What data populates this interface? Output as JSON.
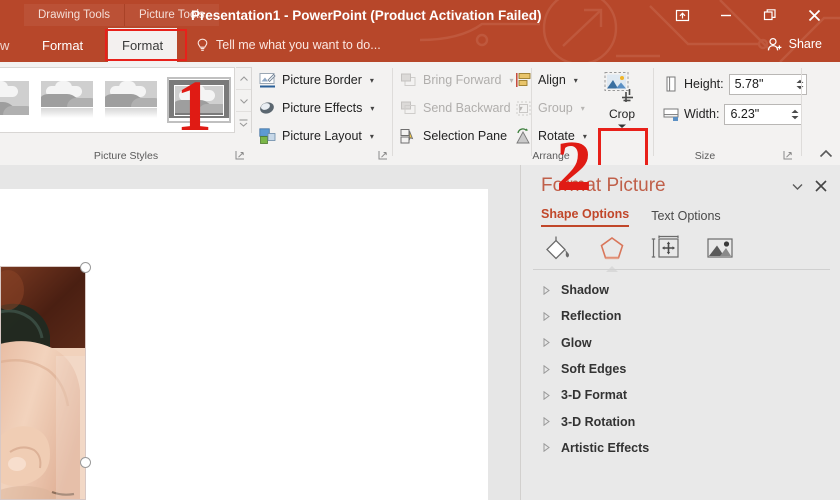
{
  "window": {
    "title": "Presentation1 - PowerPoint (Product Activation Failed)",
    "contextual_groups": [
      "Drawing Tools",
      "Picture Tools"
    ],
    "controls": [
      {
        "name": "ribbon-display-options",
        "label": "Ribbon Display Options"
      },
      {
        "name": "minimize",
        "label": "Minimize"
      },
      {
        "name": "restore",
        "label": "Restore Down"
      },
      {
        "name": "close",
        "label": "Close"
      }
    ],
    "accent_color": "#b7472a",
    "ribbon_bg": "#f3f2f1"
  },
  "tabs": {
    "partial_left": "w",
    "drawing_format": "Format",
    "picture_format": "Format",
    "active": "Format",
    "highlight_color": "#e8201a"
  },
  "tellme": {
    "placeholder": "Tell me what you want to do...",
    "icon": "lightbulb-icon"
  },
  "share": {
    "label": "Share",
    "icon": "person-add-icon"
  },
  "ribbon": {
    "groups": [
      {
        "name": "picture-styles",
        "label": "Picture Styles"
      },
      {
        "name": "arrange",
        "label": "Arrange"
      },
      {
        "name": "size",
        "label": "Size"
      }
    ],
    "picture_styles": {
      "label": "Picture Styles",
      "thumbnails": [
        "style-simple-frame",
        "style-beveled-matte",
        "style-reflected-rounded",
        "style-thick-matte-selected"
      ],
      "scroll_buttons": [
        "scroll-up",
        "scroll-down",
        "more-styles"
      ]
    },
    "picture_commands": [
      {
        "name": "picture-border",
        "label": "Picture Border",
        "has_caret": true,
        "disabled": false
      },
      {
        "name": "picture-effects",
        "label": "Picture Effects",
        "has_caret": true,
        "disabled": false
      },
      {
        "name": "picture-layout",
        "label": "Picture Layout",
        "has_caret": true,
        "disabled": false
      }
    ],
    "arrange_commands": [
      {
        "name": "bring-forward",
        "label": "Bring Forward",
        "has_caret": true,
        "disabled": true
      },
      {
        "name": "send-backward",
        "label": "Send Backward",
        "has_caret": true,
        "disabled": true
      },
      {
        "name": "selection-pane",
        "label": "Selection Pane",
        "has_caret": false,
        "disabled": false
      },
      {
        "name": "align",
        "label": "Align",
        "has_caret": true,
        "disabled": false
      },
      {
        "name": "group",
        "label": "Group",
        "has_caret": true,
        "disabled": true
      },
      {
        "name": "rotate",
        "label": "Rotate",
        "has_caret": true,
        "disabled": false
      }
    ],
    "crop": {
      "label": "Crop",
      "icon": "crop-icon",
      "highlighted": true
    },
    "size": {
      "label": "Size",
      "height_label": "Height:",
      "height_value": "5.78\"",
      "width_label": "Width:",
      "width_value": "6.23\""
    },
    "collapse_icon": "chevron-up-icon"
  },
  "annotations": [
    {
      "name": "step-1-marker",
      "text": "1"
    },
    {
      "name": "step-2-marker",
      "text": "2"
    }
  ],
  "slide": {
    "selected_image": {
      "name": "hand-photo",
      "selected": true,
      "handles": [
        "top-right",
        "bottom-right"
      ]
    }
  },
  "pane": {
    "title": "Format Picture",
    "title_color": "#c0604a",
    "dropdown_icon": "chevron-down-icon",
    "close_icon": "close-icon",
    "tabs": [
      {
        "name": "shape-options",
        "label": "Shape Options",
        "active": true
      },
      {
        "name": "text-options",
        "label": "Text Options",
        "active": false
      }
    ],
    "icons": [
      {
        "name": "fill-and-line-icon",
        "active": false
      },
      {
        "name": "effects-icon",
        "active": true
      },
      {
        "name": "size-and-properties-icon",
        "active": false
      },
      {
        "name": "picture-icon",
        "active": false
      }
    ],
    "sections": [
      {
        "name": "shadow",
        "label": "Shadow"
      },
      {
        "name": "reflection",
        "label": "Reflection"
      },
      {
        "name": "glow",
        "label": "Glow"
      },
      {
        "name": "soft-edges",
        "label": "Soft Edges"
      },
      {
        "name": "3d-format",
        "label": "3-D Format"
      },
      {
        "name": "3d-rotation",
        "label": "3-D Rotation"
      },
      {
        "name": "artistic-effects",
        "label": "Artistic Effects"
      }
    ]
  }
}
